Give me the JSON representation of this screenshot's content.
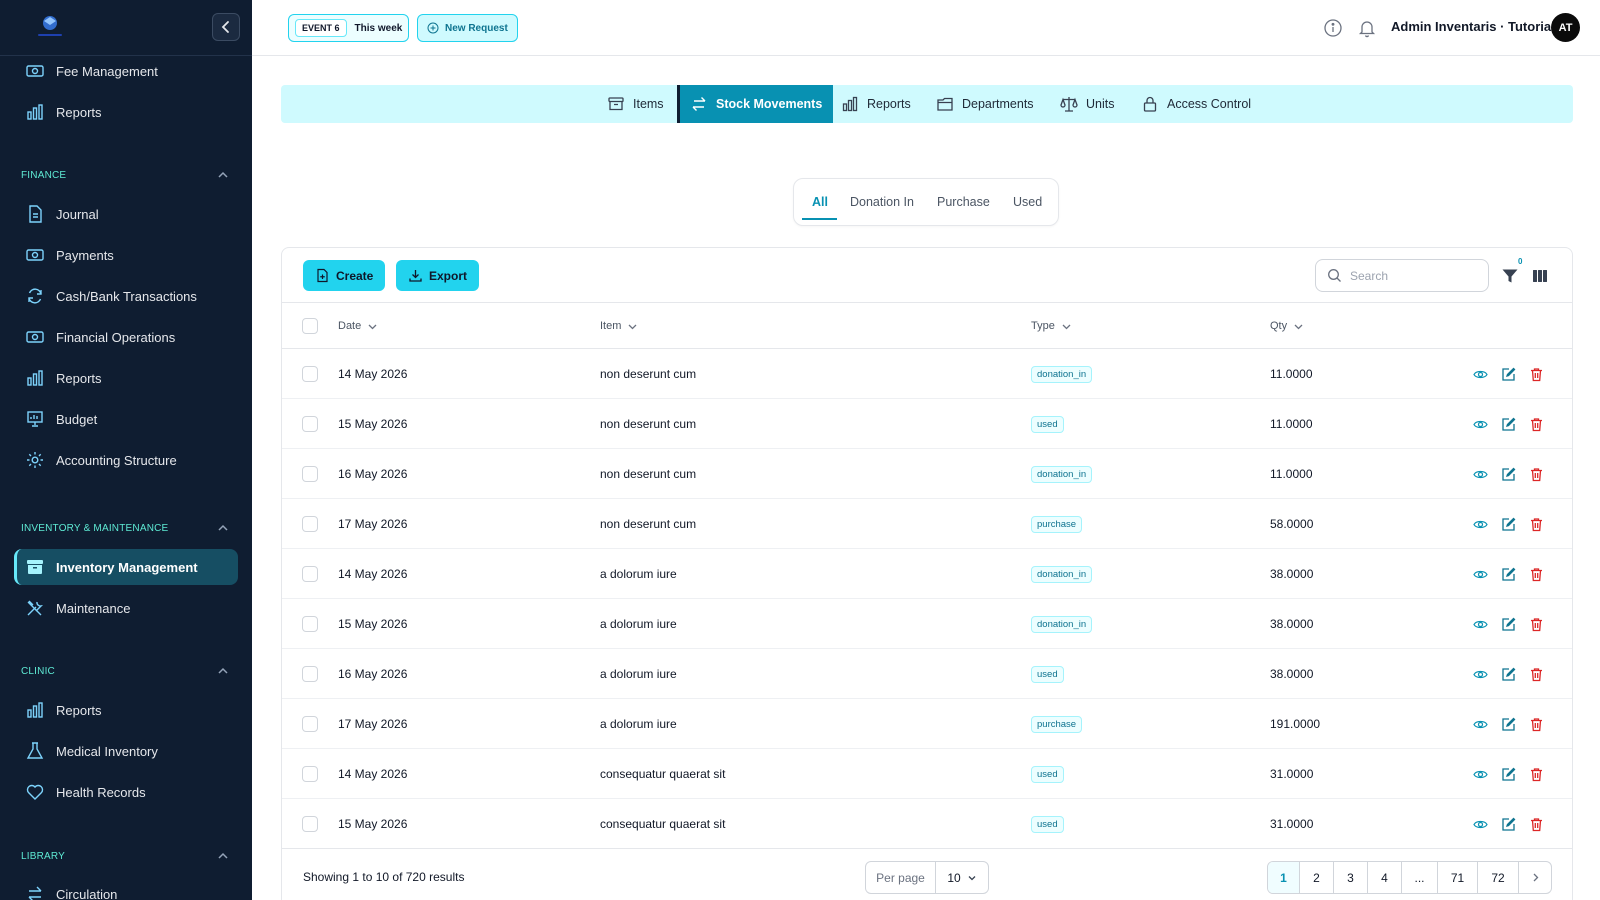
{
  "sidebar": {
    "top_items": [
      {
        "label": "Fee Management",
        "icon": "banknote-icon"
      },
      {
        "label": "Reports",
        "icon": "bar-chart-icon"
      }
    ],
    "sections": [
      {
        "title": "FINANCE",
        "items": [
          {
            "label": "Journal",
            "icon": "document-icon"
          },
          {
            "label": "Payments",
            "icon": "banknote-icon"
          },
          {
            "label": "Cash/Bank Transactions",
            "icon": "refresh-icon"
          },
          {
            "label": "Financial Operations",
            "icon": "banknote-icon"
          },
          {
            "label": "Reports",
            "icon": "bar-chart-icon"
          },
          {
            "label": "Budget",
            "icon": "presentation-chart-icon"
          },
          {
            "label": "Accounting Structure",
            "icon": "gear-icon"
          }
        ]
      },
      {
        "title": "INVENTORY & MAINTENANCE",
        "items": [
          {
            "label": "Inventory Management",
            "icon": "archive-box-icon",
            "active": true
          },
          {
            "label": "Maintenance",
            "icon": "wrench-screwdriver-icon"
          }
        ]
      },
      {
        "title": "CLINIC",
        "items": [
          {
            "label": "Reports",
            "icon": "bar-chart-icon"
          },
          {
            "label": "Medical Inventory",
            "icon": "flask-icon"
          },
          {
            "label": "Health Records",
            "icon": "heart-icon"
          }
        ]
      },
      {
        "title": "LIBRARY",
        "items": [
          {
            "label": "Circulation",
            "icon": "arrows-exchange-icon"
          }
        ]
      }
    ]
  },
  "header": {
    "event_tag": "EVENT 6",
    "event_period": "This week",
    "new_request_label": "New Request",
    "user_name": "Admin Inventaris · Tutorial",
    "avatar_initials": "AT"
  },
  "module_tabs": [
    {
      "label": "Items",
      "icon": "archive-box-icon"
    },
    {
      "label": "Stock Movements",
      "icon": "arrows-exchange-icon",
      "active": true
    },
    {
      "label": "Reports",
      "icon": "bar-chart-icon"
    },
    {
      "label": "Departments",
      "icon": "folder-icon"
    },
    {
      "label": "Units",
      "icon": "scale-icon"
    },
    {
      "label": "Access Control",
      "icon": "lock-icon"
    }
  ],
  "type_filter": {
    "tabs": [
      "All",
      "Donation In",
      "Purchase",
      "Used"
    ],
    "active": "All"
  },
  "toolbar": {
    "create_label": "Create",
    "export_label": "Export",
    "search_placeholder": "Search",
    "filter_count": "0"
  },
  "table": {
    "columns": [
      "Date",
      "Item",
      "Type",
      "Qty"
    ],
    "rows": [
      {
        "date": "14 May 2026",
        "item": "non deserunt cum",
        "type": "donation_in",
        "qty": "11.0000"
      },
      {
        "date": "15 May 2026",
        "item": "non deserunt cum",
        "type": "used",
        "qty": "11.0000"
      },
      {
        "date": "16 May 2026",
        "item": "non deserunt cum",
        "type": "donation_in",
        "qty": "11.0000"
      },
      {
        "date": "17 May 2026",
        "item": "non deserunt cum",
        "type": "purchase",
        "qty": "58.0000"
      },
      {
        "date": "14 May 2026",
        "item": "a dolorum iure",
        "type": "donation_in",
        "qty": "38.0000"
      },
      {
        "date": "15 May 2026",
        "item": "a dolorum iure",
        "type": "donation_in",
        "qty": "38.0000"
      },
      {
        "date": "16 May 2026",
        "item": "a dolorum iure",
        "type": "used",
        "qty": "38.0000"
      },
      {
        "date": "17 May 2026",
        "item": "a dolorum iure",
        "type": "purchase",
        "qty": "191.0000"
      },
      {
        "date": "14 May 2026",
        "item": "consequatur quaerat sit",
        "type": "used",
        "qty": "31.0000"
      },
      {
        "date": "15 May 2026",
        "item": "consequatur quaerat sit",
        "type": "used",
        "qty": "31.0000"
      }
    ]
  },
  "footer": {
    "summary": "Showing 1 to 10 of 720 results",
    "per_page_label": "Per page",
    "per_page_value": "10",
    "pages": [
      "1",
      "2",
      "3",
      "4",
      "...",
      "71",
      "72"
    ],
    "active_page": "1"
  },
  "colors": {
    "sidebar_bg": "#0f1d31",
    "accent": "#0891b2",
    "accent_light": "#cffafe",
    "button": "#22d3ee",
    "danger": "#dc2626"
  }
}
